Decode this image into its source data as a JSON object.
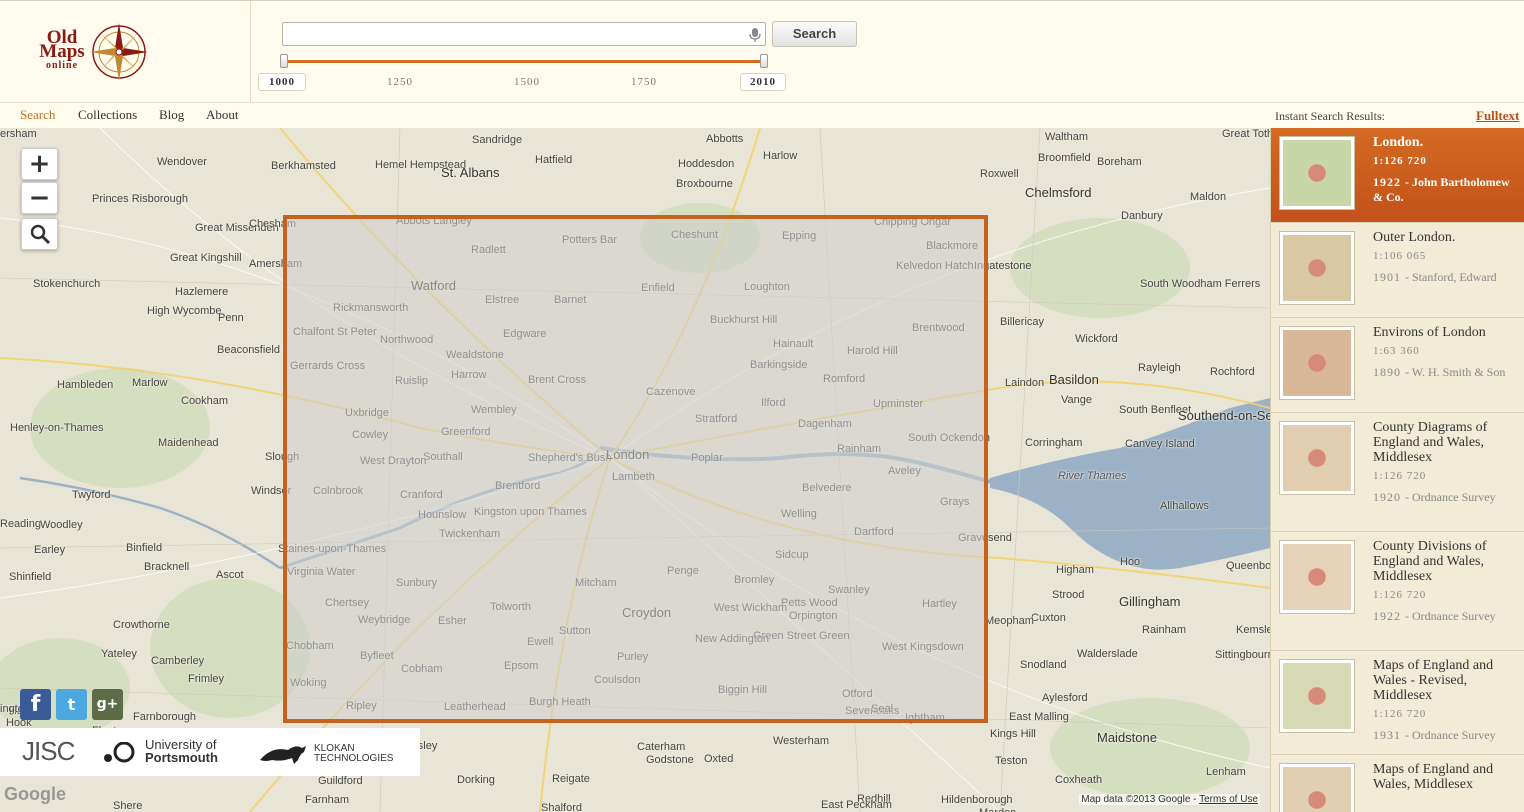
{
  "logo": {
    "line1": "Old",
    "line2": "Maps",
    "line3": "online"
  },
  "search": {
    "placeholder": "",
    "button_label": "Search"
  },
  "timeline": {
    "start": "1000",
    "end": "2010",
    "ticks": [
      "1250",
      "1500",
      "1750"
    ]
  },
  "nav": {
    "items": [
      "Search",
      "Collections",
      "Blog",
      "About"
    ],
    "active": "Search",
    "instant_label": "Instant Search Results:",
    "fulltext": "Fulltext"
  },
  "colors": {
    "accent": "#c6621d",
    "background": "#fffcef"
  },
  "map": {
    "places": [
      {
        "text": "Sandridge"
      },
      {
        "text": "Abbotts"
      },
      {
        "text": "Waltham"
      },
      {
        "text": "Great Totham"
      },
      {
        "text": "Wendover"
      },
      {
        "text": "Berkhamsted"
      },
      {
        "text": "Hemel Hempstead"
      },
      {
        "text": "St. Albans"
      },
      {
        "text": "Hatfield"
      },
      {
        "text": "Hoddesdon"
      },
      {
        "text": "Harlow"
      },
      {
        "text": "Broomfield"
      },
      {
        "text": "Boreham"
      },
      {
        "text": "Broxbourne"
      },
      {
        "text": "Roxwell"
      },
      {
        "text": "Chelmsford"
      },
      {
        "text": "Maldon"
      },
      {
        "text": "Princes Risborough"
      },
      {
        "text": "Great Missenden"
      },
      {
        "text": "Chesham"
      },
      {
        "text": "Abbots Langley"
      },
      {
        "text": "Radlett"
      },
      {
        "text": "Potters Bar"
      },
      {
        "text": "Cheshunt"
      },
      {
        "text": "Epping"
      },
      {
        "text": "Chipping Ongar"
      },
      {
        "text": "Blackmore"
      },
      {
        "text": "Danbury"
      },
      {
        "text": "Great Kingshill"
      },
      {
        "text": "Amersham"
      },
      {
        "text": "Kelvedon Hatch"
      },
      {
        "text": "Ingatestone"
      },
      {
        "text": "Stokenchurch"
      },
      {
        "text": "Hazlemere"
      },
      {
        "text": "Watford"
      },
      {
        "text": "Elstree"
      },
      {
        "text": "Barnet"
      },
      {
        "text": "Enfield"
      },
      {
        "text": "Loughton"
      },
      {
        "text": "South Woodham Ferrers"
      },
      {
        "text": "High Wycombe"
      },
      {
        "text": "Penn"
      },
      {
        "text": "Rickmansworth"
      },
      {
        "text": "Buckhurst Hill"
      },
      {
        "text": "Brentwood"
      },
      {
        "text": "Billericay"
      },
      {
        "text": "Chalfont St Peter"
      },
      {
        "text": "Northwood"
      },
      {
        "text": "Edgware"
      },
      {
        "text": "Wickford"
      },
      {
        "text": "Beaconsfield"
      },
      {
        "text": "Wealdstone"
      },
      {
        "text": "Hainault"
      },
      {
        "text": "Harold Hill"
      },
      {
        "text": "Gerrards Cross"
      },
      {
        "text": "Barkingside"
      },
      {
        "text": "Rayleigh"
      },
      {
        "text": "Rochford"
      },
      {
        "text": "Hambleden"
      },
      {
        "text": "Marlow"
      },
      {
        "text": "Ruislip"
      },
      {
        "text": "Harrow"
      },
      {
        "text": "Brent Cross"
      },
      {
        "text": "Romford"
      },
      {
        "text": "Laindon"
      },
      {
        "text": "Basildon"
      },
      {
        "text": "Cookham"
      },
      {
        "text": "Cazenove"
      },
      {
        "text": "Vange"
      },
      {
        "text": "Uxbridge"
      },
      {
        "text": "Wembley"
      },
      {
        "text": "Ilford"
      },
      {
        "text": "Upminster"
      },
      {
        "text": "Stratford"
      },
      {
        "text": "South Benfleet"
      },
      {
        "text": "Southend-on-Sea"
      },
      {
        "text": "Henley-on-Thames"
      },
      {
        "text": "Maidenhead"
      },
      {
        "text": "Cowley"
      },
      {
        "text": "Greenford"
      },
      {
        "text": "Dagenham"
      },
      {
        "text": "South Ockendon"
      },
      {
        "text": "Corringham"
      },
      {
        "text": "Canvey Island"
      },
      {
        "text": "Slough"
      },
      {
        "text": "Southall"
      },
      {
        "text": "Shepherd's Bush"
      },
      {
        "text": "London"
      },
      {
        "text": "Poplar"
      },
      {
        "text": "Rainham"
      },
      {
        "text": "West Drayton"
      },
      {
        "text": "Lambeth"
      },
      {
        "text": "Aveley"
      },
      {
        "text": "River Thames"
      },
      {
        "text": "Windsor"
      },
      {
        "text": "Twyford"
      },
      {
        "text": "Colnbrook"
      },
      {
        "text": "Cranford"
      },
      {
        "text": "Brentford"
      },
      {
        "text": "Belvedere"
      },
      {
        "text": "Grays"
      },
      {
        "text": "Allhallows"
      },
      {
        "text": "Reading"
      },
      {
        "text": "Woodley"
      },
      {
        "text": "Hounslow"
      },
      {
        "text": "Welling"
      },
      {
        "text": "Twickenham"
      },
      {
        "text": "Dartford"
      },
      {
        "text": "Gravesend"
      },
      {
        "text": "Earley"
      },
      {
        "text": "Binfield"
      },
      {
        "text": "Staines-upon-Thames"
      },
      {
        "text": "Kingston upon Thames"
      },
      {
        "text": "Sidcup"
      },
      {
        "text": "Higham"
      },
      {
        "text": "Hoo"
      },
      {
        "text": "Queenborough"
      },
      {
        "text": "Bracknell"
      },
      {
        "text": "Penge"
      },
      {
        "text": "Shinfield"
      },
      {
        "text": "Ascot"
      },
      {
        "text": "Virginia Water"
      },
      {
        "text": "Sunbury"
      },
      {
        "text": "Mitcham"
      },
      {
        "text": "Bromley"
      },
      {
        "text": "Swanley"
      },
      {
        "text": "Strood"
      },
      {
        "text": "Gillingham"
      },
      {
        "text": "Chertsey"
      },
      {
        "text": "Tolworth"
      },
      {
        "text": "Petts Wood"
      },
      {
        "text": "Hartley"
      },
      {
        "text": "Crowthorne"
      },
      {
        "text": "Weybridge"
      },
      {
        "text": "Esher"
      },
      {
        "text": "Croydon"
      },
      {
        "text": "West Wickham"
      },
      {
        "text": "Orpington"
      },
      {
        "text": "Cuxton"
      },
      {
        "text": "Meopham"
      },
      {
        "text": "Rainham"
      },
      {
        "text": "Kemsley"
      },
      {
        "text": "Yateley"
      },
      {
        "text": "Camberley"
      },
      {
        "text": "Chobham"
      },
      {
        "text": "Ewell"
      },
      {
        "text": "Sutton"
      },
      {
        "text": "Green Street Green"
      },
      {
        "text": "New Addington"
      },
      {
        "text": "Walderslade"
      },
      {
        "text": "Sittingbourne"
      },
      {
        "text": "Frimley"
      },
      {
        "text": "Byfleet"
      },
      {
        "text": "Purley"
      },
      {
        "text": "West Kingsdown"
      },
      {
        "text": "Cobham"
      },
      {
        "text": "Epsom"
      },
      {
        "text": "Snodland"
      },
      {
        "text": "Coulsdon"
      },
      {
        "text": "Woking"
      },
      {
        "text": "Biggin Hill"
      },
      {
        "text": "Otford"
      },
      {
        "text": "Aylesford"
      },
      {
        "text": "Hook"
      },
      {
        "text": "Farnborough"
      },
      {
        "text": "Ripley"
      },
      {
        "text": "Burgh Heath"
      },
      {
        "text": "Leatherhead"
      },
      {
        "text": "East Malling"
      },
      {
        "text": "Sevenoaks"
      },
      {
        "text": "Seal"
      },
      {
        "text": "Ightham"
      },
      {
        "text": "Fleet"
      },
      {
        "text": "East Horsley"
      },
      {
        "text": "Caterham"
      },
      {
        "text": "Westerham"
      },
      {
        "text": "Kings Hill"
      },
      {
        "text": "Maidstone"
      },
      {
        "text": "Guildford"
      },
      {
        "text": "Oxted"
      },
      {
        "text": "Teston"
      },
      {
        "text": "Godstone"
      },
      {
        "text": "Dorking"
      },
      {
        "text": "Reigate"
      },
      {
        "text": "Coxheath"
      },
      {
        "text": "Lenham"
      },
      {
        "text": "Shere"
      },
      {
        "text": "Farnham"
      },
      {
        "text": "Shalford"
      },
      {
        "text": "Redhill"
      },
      {
        "text": "Hildenborough"
      },
      {
        "text": "East Peckham"
      },
      {
        "text": "Marden"
      },
      {
        "text": "Ham"
      },
      {
        "text": "ington"
      },
      {
        "text": "ersham"
      }
    ],
    "zoom_in": "+",
    "zoom_out": "−",
    "search_icon": "magnifier-icon",
    "social": {
      "facebook": "f",
      "twitter": "t",
      "gplus": "g+"
    },
    "partners": {
      "jisc": "JISC",
      "uop_line1": "University of",
      "uop_line2": "Portsmouth",
      "klokan_line1": "KLOKAN",
      "klokan_line2": "TECHNOLOGIES"
    },
    "google": "Google",
    "map_data": "Map data ©2013 Google - ",
    "terms": "Terms of Use"
  },
  "results": [
    {
      "title": "London.",
      "scale": "1:126 720",
      "year": "1922",
      "author": "- John Bartholomew & Co.",
      "active": true
    },
    {
      "title": "Outer London.",
      "scale": "1:106 065",
      "year": "1901",
      "author": "- Stanford, Edward",
      "active": false
    },
    {
      "title": "Environs of London",
      "scale": "1:63 360",
      "year": "1890",
      "author": "- W. H. Smith & Son",
      "active": false
    },
    {
      "title": "County Diagrams of England and Wales, Middlesex",
      "scale": "1:126 720",
      "year": "1920",
      "author": "- Ordnance Survey",
      "active": false
    },
    {
      "title": "County Divisions of England and Wales, Middlesex",
      "scale": "1:126 720",
      "year": "1922",
      "author": "- Ordnance Survey",
      "active": false
    },
    {
      "title": "Maps of England and Wales - Revised, Middlesex",
      "scale": "1:126 720",
      "year": "1931",
      "author": "- Ordnance Survey",
      "active": false
    },
    {
      "title": "Maps of England and Wales, Middlesex",
      "scale": "1:126 720",
      "year": "",
      "author": "",
      "active": false
    }
  ]
}
